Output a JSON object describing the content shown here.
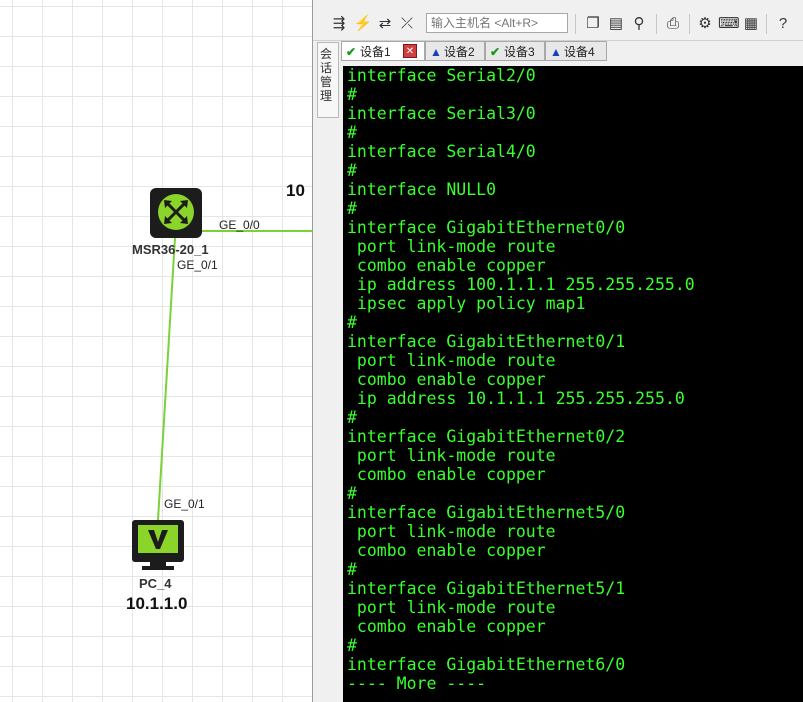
{
  "topology": {
    "router": {
      "name": "MSR36-20_1",
      "port_right": "GE_0/0",
      "port_down": "GE_0/1"
    },
    "pc": {
      "name": "PC_4",
      "ip": "10.1.1.0",
      "port": "GE_0/1"
    },
    "partial_label": "10",
    "link_color": "#7bd13a"
  },
  "app": {
    "toolbar": {
      "host_placeholder": "输入主机名 <Alt+R>"
    },
    "side_tab": "会话管理",
    "tabs": [
      {
        "label": "设备1",
        "status": "ok"
      },
      {
        "label": "设备2",
        "status": "warn"
      },
      {
        "label": "设备3",
        "status": "ok"
      },
      {
        "label": "设备4",
        "status": "warn"
      }
    ],
    "terminal": {
      "text_color": "#39ff2e",
      "background": "#000000",
      "lines": [
        "interface Serial2/0",
        "#",
        "interface Serial3/0",
        "#",
        "interface Serial4/0",
        "#",
        "interface NULL0",
        "#",
        "interface GigabitEthernet0/0",
        " port link-mode route",
        " combo enable copper",
        " ip address 100.1.1.1 255.255.255.0",
        " ipsec apply policy map1",
        "#",
        "interface GigabitEthernet0/1",
        " port link-mode route",
        " combo enable copper",
        " ip address 10.1.1.1 255.255.255.0",
        "#",
        "interface GigabitEthernet0/2",
        " port link-mode route",
        " combo enable copper",
        "#",
        "interface GigabitEthernet5/0",
        " port link-mode route",
        " combo enable copper",
        "#",
        "interface GigabitEthernet5/1",
        " port link-mode route",
        " combo enable copper",
        "#",
        "interface GigabitEthernet6/0",
        "---- More ----"
      ]
    }
  }
}
